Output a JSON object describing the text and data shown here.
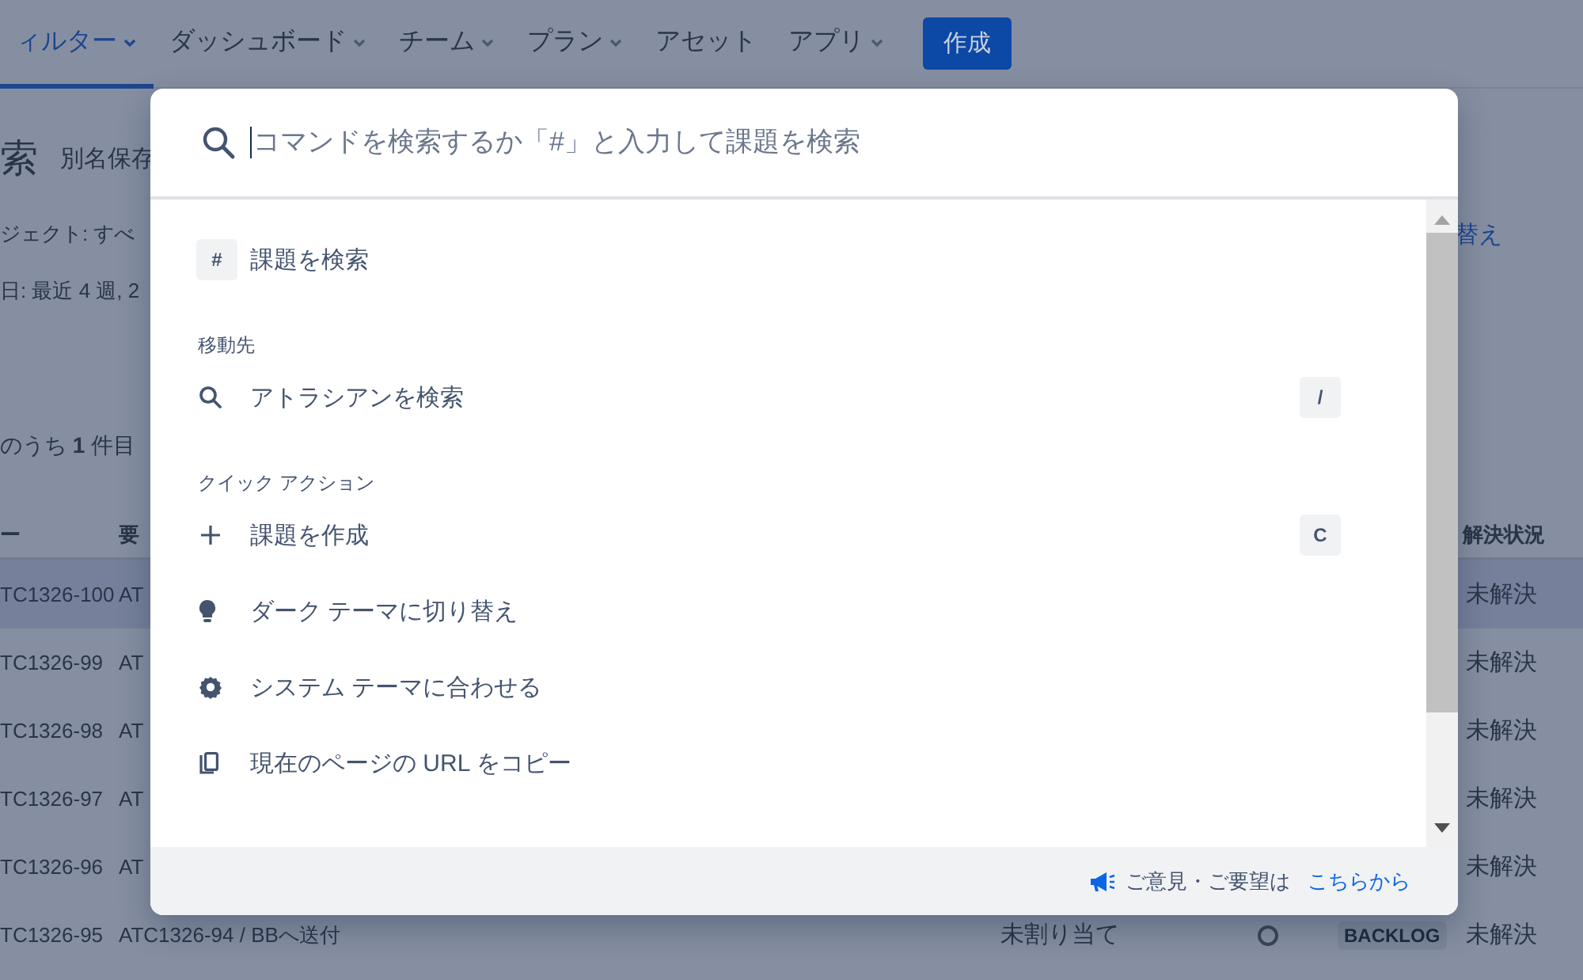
{
  "nav": {
    "items": [
      {
        "label": "ィルター",
        "selected": true,
        "dropdown": true
      },
      {
        "label": "ダッシュボード",
        "selected": false,
        "dropdown": true
      },
      {
        "label": "チーム",
        "selected": false,
        "dropdown": true
      },
      {
        "label": "プラン",
        "selected": false,
        "dropdown": true
      },
      {
        "label": "アセット",
        "selected": false,
        "dropdown": false
      },
      {
        "label": "アプリ",
        "selected": false,
        "dropdown": true
      }
    ],
    "create_button": "作成"
  },
  "page": {
    "title": "索",
    "save_as": "別名保存",
    "filters": [
      "ジェクト: すべ",
      "日: 最近 4 週, 2"
    ],
    "switch_link": "替え",
    "count": "のうち **1** 件目"
  },
  "table": {
    "columns": [
      "ー",
      "要",
      "解決状況"
    ],
    "rows": [
      {
        "key": "TC1326-100",
        "summary": "AT",
        "resolution": "未解決",
        "selected": true
      },
      {
        "key": "TC1326-99",
        "summary": "AT",
        "resolution": "未解決",
        "selected": false
      },
      {
        "key": "TC1326-98",
        "summary": "AT",
        "resolution": "未解決",
        "selected": false
      },
      {
        "key": "TC1326-97",
        "summary": "AT",
        "resolution": "未解決",
        "selected": false
      },
      {
        "key": "TC1326-96",
        "summary": "AT",
        "resolution": "未解決",
        "selected": false
      },
      {
        "key": "TC1326-95",
        "summary": "ATC1326-94 / BBへ送付",
        "assignee": "未割り当て",
        "status": "BACKLOG",
        "resolution": "未解決",
        "selected": false
      }
    ]
  },
  "palette": {
    "search": {
      "placeholder": "コマンドを検索するか「#」と入力して課題を検索"
    },
    "sections": [
      {
        "items": [
          {
            "kind": "hash",
            "key": "#",
            "label": "課題を検索"
          }
        ]
      },
      {
        "heading": "移動先",
        "items": [
          {
            "kind": "search",
            "label": "アトラシアンを検索",
            "shortcut": "/"
          }
        ]
      },
      {
        "heading": "クイック アクション",
        "items": [
          {
            "kind": "plus",
            "label": "課題を作成",
            "shortcut": "C"
          },
          {
            "kind": "bulb",
            "label": "ダーク テーマに切り替え"
          },
          {
            "kind": "gear",
            "label": "システム テーマに合わせる"
          },
          {
            "kind": "copy",
            "label": "現在のページの URL をコピー"
          }
        ]
      }
    ],
    "footer": {
      "text": "ご意見・ご要望は",
      "link": "こちらから"
    }
  }
}
